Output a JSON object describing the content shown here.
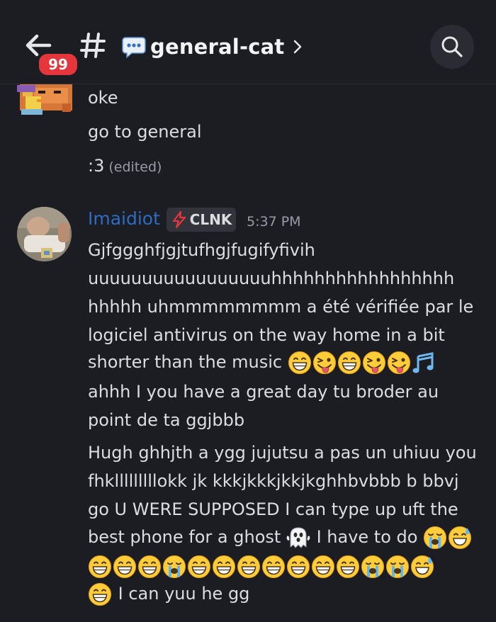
{
  "header": {
    "unread_badge": "99",
    "channel_name": "general-cat",
    "colors": {
      "badge": "#e5373b",
      "username": "#2d6cc4"
    }
  },
  "messages": {
    "previous": {
      "lines": [
        "oke",
        "go to general",
        ":3"
      ],
      "edited_label": "(edited)"
    },
    "current": {
      "username": "Imaidiot",
      "tag": "CLNK",
      "timestamp": "5:37 PM",
      "lines": [
        "Gjfggghfjgjtufhgjfugifyfivih",
        "uuuuuuuuuuuuuuuuuhhhhhhhhhhhhhhhhh",
        "hhhhh uhmmmmmmmm a été vérifiée par le",
        "logiciel antivirus on the way home in a bit",
        "shorter than the music",
        "ahhh I you have a great day tu broder au",
        "point de ta ggjbbb",
        "Hugh ghhjth a ygg jujutsu a pas un uhiuu you",
        "fhklllllllllokk jk kkkjkkkjkkjkghhbvbbb b bbvj",
        "go U WERE SUPPOSED I can type up uft the",
        "best phone for a ghost",
        "I have to do",
        "I can yuu he gg"
      ],
      "emoji": {
        "line5": [
          "grin",
          "tongue",
          "grin",
          "tongue",
          "tongue",
          "music-notes"
        ],
        "ghost": "ghost",
        "line12": [
          "sob",
          "sweat-smile"
        ],
        "row13": [
          "grin",
          "grin",
          "grin",
          "sob",
          "grin",
          "grin",
          "grin",
          "grin",
          "grin",
          "grin",
          "grin",
          "sob",
          "sob",
          "sweat-smile"
        ],
        "row14": [
          "grin"
        ]
      }
    }
  }
}
